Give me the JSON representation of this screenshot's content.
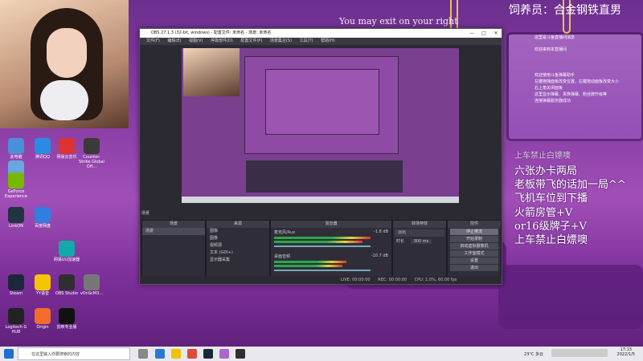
{
  "overlay": {
    "title": "饲养员：合金钢铁直男",
    "quote": "You may exit on your right",
    "chat_lines": [
      "这里是斗鱼直播间消息",
      "欢迎来到本直播间",
      "欢迎使用斗鱼弹幕助手",
      "左键拖拽面板改变位置，右键拖动面板改变大小",
      "右上角关闭面板",
      "这里显示弹幕、贵族弹幕、粉丝牌升级等",
      "连接弹幕服务器成功"
    ],
    "big_lines": [
      "上车禁止白嫖噢",
      "六张办卡两局",
      "老板带飞的话加一局^^",
      "飞机车位到下播",
      "火箭房管+V",
      "or16级牌子+V",
      "上车禁止白嫖噢"
    ]
  },
  "desktop": {
    "icons": [
      {
        "label": "此电脑",
        "color": "#4a8fd8"
      },
      {
        "label": "Counter-Strike Global Off...",
        "color": "#3a3a3a"
      },
      {
        "label": "回收站",
        "color": "#6aa6e0"
      },
      {
        "label": "腾讯QQ",
        "color": "#2a8be0"
      },
      {
        "label": "网易云音乐",
        "color": "#d33"
      },
      {
        "label": "GeForce Experience",
        "color": "#76b900"
      },
      {
        "label": "百度网盘",
        "color": "#2f7fe0"
      },
      {
        "label": "网易UU加速器",
        "color": "#1aa"
      },
      {
        "label": "Steam",
        "color": "#1b2838"
      },
      {
        "label": "YY语音",
        "color": "#f5c400"
      },
      {
        "label": "OBS Studio",
        "color": "#302e31"
      },
      {
        "label": "Origin",
        "color": "#f56c2d"
      },
      {
        "label": "剪映专业版",
        "color": "#111"
      },
      {
        "label": "Logitech G HUB",
        "color": "#222"
      },
      {
        "label": "LinkON",
        "color": "#234"
      },
      {
        "label": "vDnScM3...",
        "color": "#777"
      }
    ]
  },
  "obs": {
    "title": "OBS 27.1.3 (32-bit, windows) - 配置文件: 未命名 - 场景: 未命名",
    "menu": [
      "文件(F)",
      "编辑(E)",
      "视图(V)",
      "停靠部件(D)",
      "配置文件(P)",
      "场景集合(S)",
      "工具(T)",
      "帮助(H)"
    ],
    "scene_label": "场景",
    "docks": {
      "scenes_header": "场景",
      "sources_header": "来源",
      "mixer_header": "混音器",
      "transitions_header": "转场特效",
      "controls_header": "控件"
    },
    "sources": [
      "图像",
      "图像",
      "视频源",
      "文本 (GDI+)",
      "显示器采集"
    ],
    "mixer": [
      {
        "name": "麦克风/Aux",
        "level": "-1.8 dB"
      },
      {
        "name": "桌面音频",
        "level": "-10.7 dB"
      }
    ],
    "transition": {
      "type": "淡出",
      "duration_label": "时长",
      "duration": "300 ms"
    },
    "controls": [
      "停止推流",
      "开始录制",
      "启动虚拟摄像机",
      "工作室模式",
      "设置",
      "退出"
    ],
    "status": {
      "live": "LIVE: 00:00:00",
      "rec": "REC: 00:00:00",
      "cpu": "CPU: 1.0%, 60.00 fps"
    }
  },
  "taskbar": {
    "search_placeholder": "在这里输入你要搜索的内容",
    "weather": "23°C 多云",
    "time": "17:13",
    "date": "2022/1/5"
  }
}
